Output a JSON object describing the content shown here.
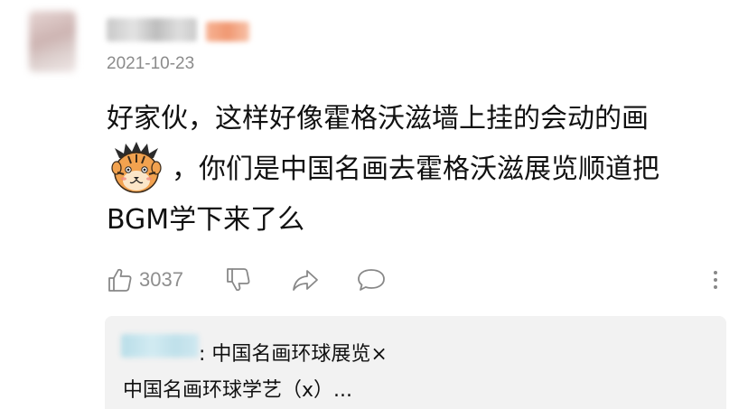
{
  "comment": {
    "date": "2021-10-23",
    "text_line1": "好家伙，这样好像霍格沃滋墙上挂的会动的画",
    "text_line2": "，你们是中国名画去霍格沃滋展览顺道把",
    "text_line3": "BGM学下来了么",
    "sticker_icon": "tiger-face-sticker"
  },
  "actions": {
    "like_count": "3037",
    "icons": [
      "thumbs-up-icon",
      "thumbs-down-icon",
      "share-icon",
      "comment-icon",
      "more-vertical-icon"
    ]
  },
  "reply": {
    "line1": ": 中国名画环球展览×",
    "line2": "中国名画环球学艺（x）..."
  },
  "colors": {
    "text": "#111111",
    "muted": "#8b8b8b",
    "reply_bg": "#f2f2f2"
  }
}
